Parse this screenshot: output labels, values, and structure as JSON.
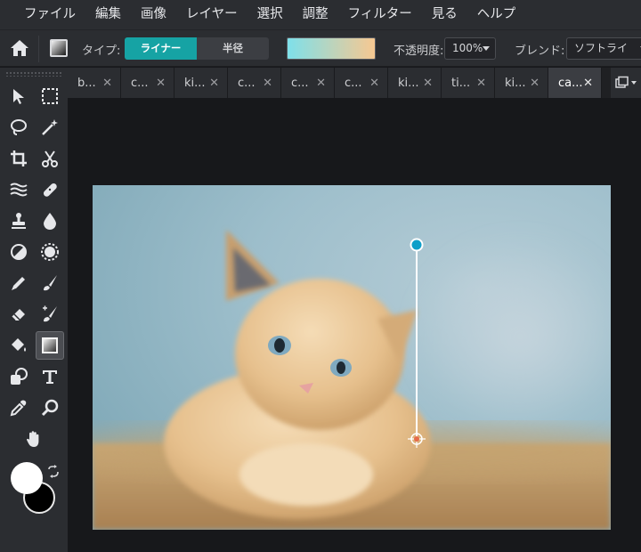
{
  "menu": [
    "ファイル",
    "編集",
    "画像",
    "レイヤー",
    "選択",
    "調整",
    "フィルター",
    "見る",
    "ヘルプ"
  ],
  "options": {
    "type_label": "タイプ:",
    "type_linear": "ライナー",
    "type_radial": "半径",
    "opacity_label": "不透明度:",
    "opacity_value": "100%",
    "blend_label": "ブレンド:",
    "blend_value": "ソフトライ",
    "gradient_start": "#7ee0ea",
    "gradient_end": "#f7c891"
  },
  "tabs": [
    {
      "label": "b...",
      "active": false
    },
    {
      "label": "c...",
      "active": false
    },
    {
      "label": "ki...",
      "active": false
    },
    {
      "label": "c...",
      "active": false
    },
    {
      "label": "c...",
      "active": false
    },
    {
      "label": "c...",
      "active": false
    },
    {
      "label": "ki...",
      "active": false
    },
    {
      "label": "ti...",
      "active": false
    },
    {
      "label": "ki...",
      "active": false
    },
    {
      "label": "ca...",
      "active": true
    }
  ],
  "tab_close_glyph": "✕",
  "tools": [
    "move-tool",
    "marquee-tool",
    "lasso-tool",
    "magic-wand-tool",
    "crop-tool",
    "cut-tool",
    "liquify-tool",
    "healing-tool",
    "stamp-tool",
    "blur-tool",
    "dodge-tool",
    "sponge-tool",
    "pencil-tool",
    "brush-tool",
    "eraser-tool",
    "replace-color-tool",
    "paint-bucket-tool",
    "gradient-tool",
    "shape-tool",
    "text-tool",
    "eyedropper-tool",
    "zoom-tool",
    "hand-tool"
  ],
  "colors": {
    "foreground": "#ffffff",
    "background": "#000000",
    "accent": "#16a3a4"
  },
  "canvas_image": "kitten photo"
}
